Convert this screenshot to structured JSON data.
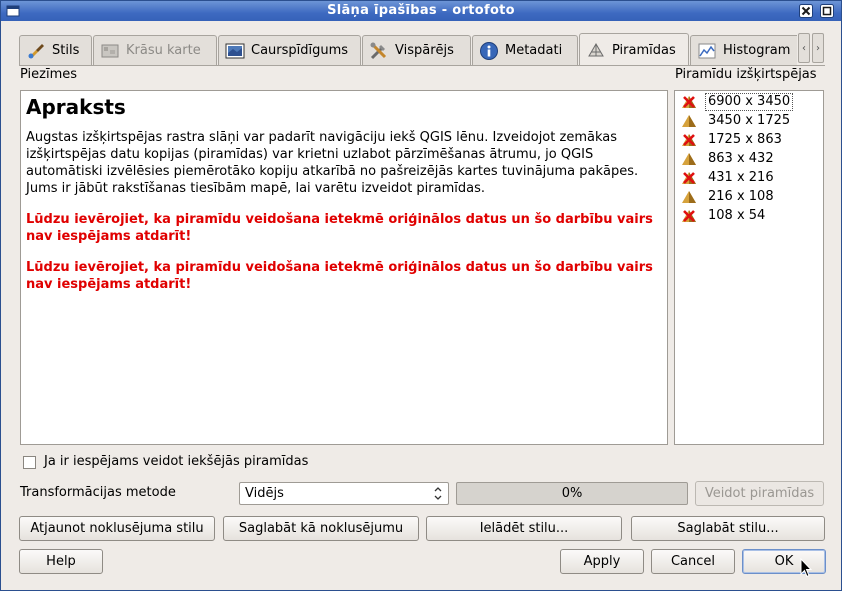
{
  "window": {
    "title": "Slāņa īpašības - ortofoto"
  },
  "tabs": [
    {
      "label": "Stils",
      "icon": "brush-icon"
    },
    {
      "label": "Krāsu karte",
      "icon": "colormap-icon",
      "disabled": true
    },
    {
      "label": "Caurspīdīgums",
      "icon": "transparency-icon"
    },
    {
      "label": "Vispārējs",
      "icon": "tools-icon"
    },
    {
      "label": "Metadati",
      "icon": "info-icon"
    },
    {
      "label": "Piramīdas",
      "icon": "pyramid-icon",
      "active": true
    },
    {
      "label": "Histogram",
      "icon": "histogram-icon"
    }
  ],
  "notes": {
    "label": "Piezīmes",
    "heading": "Apraksts",
    "body": "Augstas izšķirtspējas rastra slāņi var padarīt navigāciju iekš QGIS lēnu. Izveidojot zemākas izšķirtspējas datu kopijas (piramīdas) var krietni uzlabot pārzīmēšanas ātrumu, jo QGIS automātiski izvēlēsies piemērotāko kopiju atkarībā no pašreizējās kartes tuvinājuma pakāpes. Jums ir jābūt rakstīšanas tiesībām mapē, lai varētu izveidot piramīdas.",
    "warning1": "Lūdzu ievērojiet, ka piramīdu veidošana ietekmē oriģinālos datus un šo darbību vairs nav iespējams atdarīt!",
    "warning2": "Lūdzu ievērojiet, ka piramīdu veidošana ietekmē oriģinālos datus un šo darbību vairs nav iespējams atdarīt!"
  },
  "resolutions": {
    "label": "Piramīdu izšķirtspējas",
    "items": [
      {
        "text": "6900 x 3450",
        "icon": "no-pyramid-icon"
      },
      {
        "text": "3450 x 1725",
        "icon": "pyramid-icon"
      },
      {
        "text": "1725 x 863",
        "icon": "no-pyramid-icon"
      },
      {
        "text": "863 x 432",
        "icon": "pyramid-icon"
      },
      {
        "text": "431 x 216",
        "icon": "no-pyramid-icon"
      },
      {
        "text": "216 x 108",
        "icon": "pyramid-icon"
      },
      {
        "text": "108 x 54",
        "icon": "no-pyramid-icon"
      }
    ]
  },
  "internal_checkbox": {
    "label": "Ja ir iespējams veidot iekšējās piramīdas",
    "checked": false
  },
  "transform": {
    "label": "Transformācijas metode",
    "value": "Vidējs"
  },
  "progress": {
    "text": "0%",
    "value": 0
  },
  "buttons": {
    "build": "Veidot piramīdas",
    "restore_default": "Atjaunot noklusējuma stilu",
    "save_default": "Saglabāt kā noklusējumu",
    "load_style": "Ielādēt stilu...",
    "save_style": "Saglabāt stilu...",
    "help": "Help",
    "apply": "Apply",
    "cancel": "Cancel",
    "ok": "OK"
  },
  "colors": {
    "titlebar": "#3e6ac1",
    "warning": "#e00000",
    "progress_fill": "#6d95d6"
  }
}
